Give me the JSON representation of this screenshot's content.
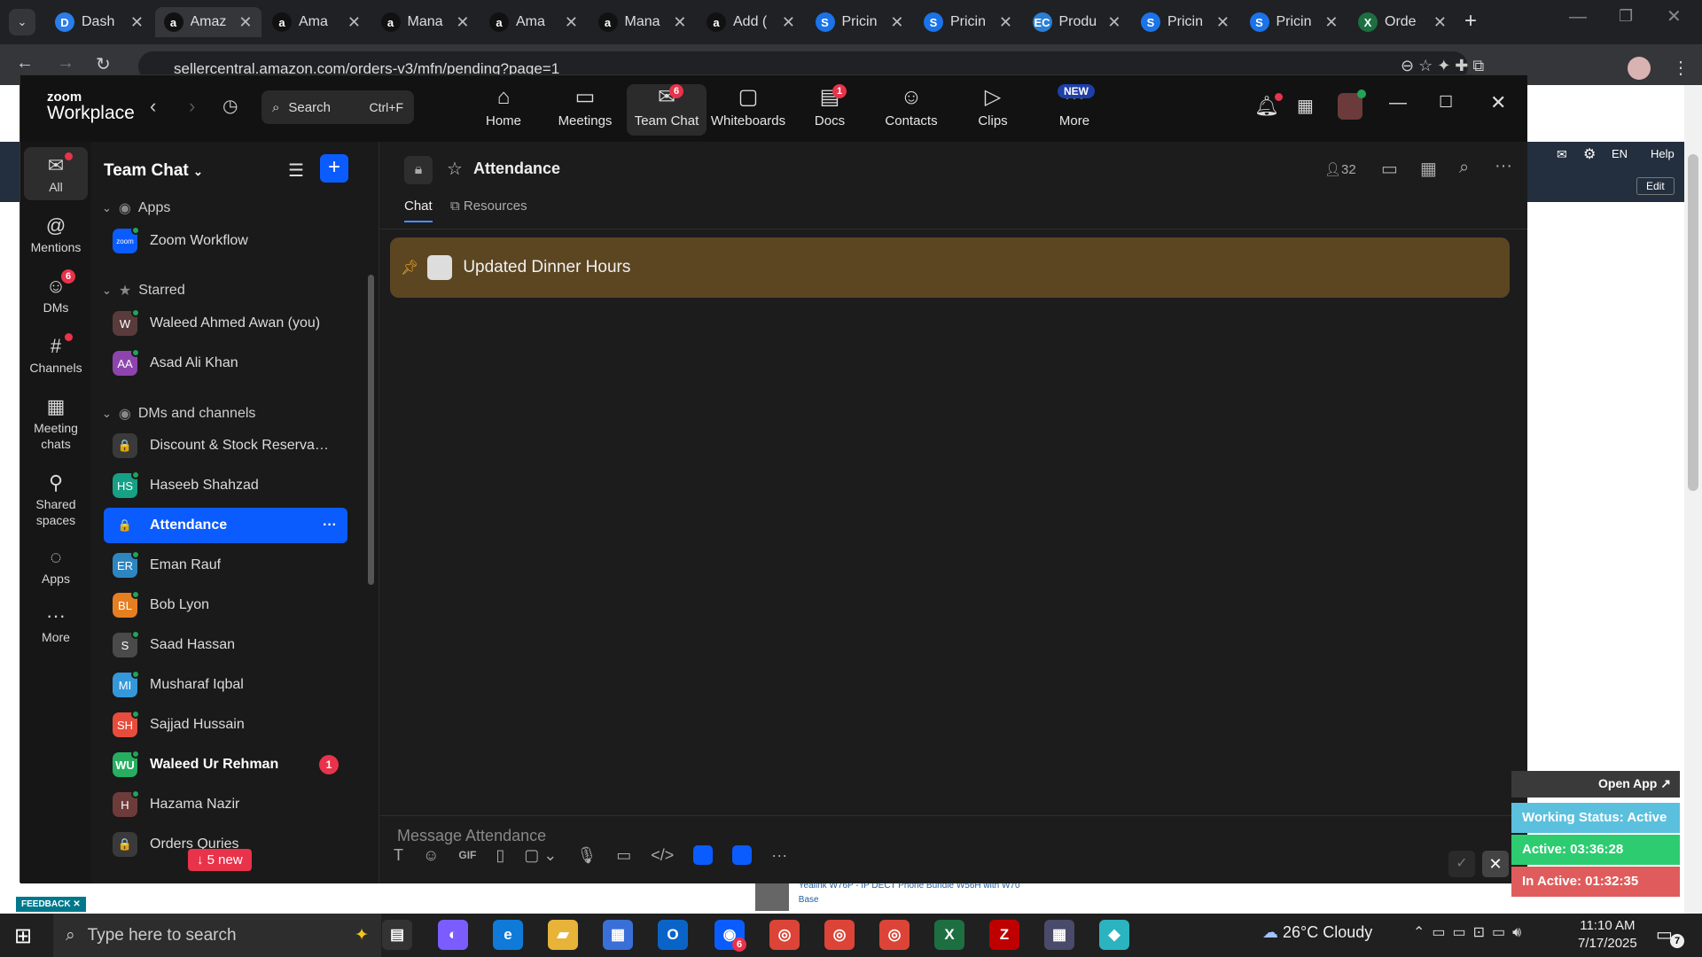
{
  "browser": {
    "tabs": [
      {
        "title": "Dash",
        "favicon": "D",
        "color": "#2b7de9"
      },
      {
        "title": "Amaz",
        "favicon": "a",
        "color": "#111111"
      },
      {
        "title": "Ama",
        "favicon": "a",
        "color": "#111111"
      },
      {
        "title": "Mana",
        "favicon": "a",
        "color": "#111111"
      },
      {
        "title": "Ama",
        "favicon": "a",
        "color": "#111111"
      },
      {
        "title": "Mana",
        "favicon": "a",
        "color": "#111111"
      },
      {
        "title": "Add (",
        "favicon": "a",
        "color": "#111111"
      },
      {
        "title": "Pricin",
        "favicon": "S",
        "color": "#1a73e8"
      },
      {
        "title": "Pricin",
        "favicon": "S",
        "color": "#1a73e8"
      },
      {
        "title": "Produ",
        "favicon": "EC",
        "color": "#2a7fd4"
      },
      {
        "title": "Pricin",
        "favicon": "S",
        "color": "#1a73e8"
      },
      {
        "title": "Pricin",
        "favicon": "S",
        "color": "#1a73e8"
      },
      {
        "title": "Orde",
        "favicon": "X",
        "color": "#1d6f42"
      }
    ],
    "url": "sellercentral.amazon.com/orders-v3/mfn/pending?page=1"
  },
  "amazon": {
    "lang": "EN",
    "help": "Help",
    "edit": "Edit",
    "feedback": "FEEDBACK",
    "product_line1": "Yealink W76P - IP DECT Phone Bundle W56H with W70",
    "product_line2": "Base",
    "open_app": "Open App"
  },
  "zoom": {
    "brand_top": "zoom",
    "brand_bottom": "Workplace",
    "search": {
      "label": "Search",
      "shortcut": "Ctrl+F"
    },
    "nav": [
      {
        "label": "Home",
        "icon": "home-icon",
        "glyph": "⌂"
      },
      {
        "label": "Meetings",
        "icon": "video-icon",
        "glyph": "▭"
      },
      {
        "label": "Team Chat",
        "icon": "chat-icon",
        "glyph": "✉",
        "badge": "6"
      },
      {
        "label": "Whiteboards",
        "icon": "whiteboard-icon",
        "glyph": "▢"
      },
      {
        "label": "Docs",
        "icon": "docs-icon",
        "glyph": "▤",
        "badge": "1"
      },
      {
        "label": "Contacts",
        "icon": "contacts-icon",
        "glyph": "☺"
      },
      {
        "label": "Clips",
        "icon": "clips-icon",
        "glyph": "▷"
      },
      {
        "label": "More",
        "icon": "more-icon",
        "glyph": "···",
        "tag": "NEW"
      }
    ],
    "rail": [
      {
        "label": "All",
        "glyph": "✉"
      },
      {
        "label": "Mentions",
        "glyph": "@"
      },
      {
        "label": "DMs",
        "glyph": "☺",
        "badge": "6"
      },
      {
        "label": "Channels",
        "glyph": "#"
      },
      {
        "label": "Meeting chats",
        "glyph": "▦"
      },
      {
        "label": "Shared spaces",
        "glyph": "⚲"
      },
      {
        "label": "Apps",
        "glyph": "◌"
      },
      {
        "label": "More",
        "glyph": "···"
      }
    ],
    "sidebar": {
      "title": "Team Chat",
      "sections": {
        "apps": "Apps",
        "starred": "Starred",
        "dms": "DMs and channels"
      },
      "apps": [
        {
          "name": "Zoom Workflow",
          "initials": "zoom",
          "color": "#0b5cff"
        }
      ],
      "starred": [
        {
          "name": "Waleed Ahmed Awan (you)",
          "initials": "W",
          "color": "#5a3b3b"
        },
        {
          "name": "Asad Ali Khan",
          "initials": "AA",
          "color": "#8e44ad"
        }
      ],
      "channels": [
        {
          "name": "Discount & Stock Reservatio...",
          "initials": "🔒",
          "color": "#3a3a3a"
        },
        {
          "name": "Haseeb Shahzad",
          "initials": "HS",
          "color": "#16a085"
        },
        {
          "name": "Attendance",
          "initials": "🔒",
          "color": "#0b5cff",
          "selected": true
        },
        {
          "name": "Eman Rauf",
          "initials": "ER",
          "color": "#2e86c1"
        },
        {
          "name": "Bob Lyon",
          "initials": "BL",
          "color": "#e67e22"
        },
        {
          "name": "Saad Hassan",
          "initials": "S",
          "color": "#4a4a4a"
        },
        {
          "name": "Musharaf Iqbal",
          "initials": "MI",
          "color": "#3498db"
        },
        {
          "name": "Sajjad Hussain",
          "initials": "SH",
          "color": "#e74c3c"
        },
        {
          "name": "Waleed Ur Rehman",
          "initials": "WU",
          "color": "#27ae60",
          "bold": true,
          "badge": "1"
        },
        {
          "name": "Hazama Nazir",
          "initials": "H",
          "color": "#6e3b3b"
        },
        {
          "name": "Orders Quries",
          "initials": "🔒",
          "color": "#3a3a3a"
        }
      ],
      "new_pill": "↓ 5 new"
    },
    "channel": {
      "name": "Attendance",
      "members": "32",
      "tabs": [
        "Chat",
        "Resources"
      ],
      "pinned": "Updated Dinner Hours",
      "composer_placeholder": "Message Attendance",
      "gif": "GIF"
    }
  },
  "widget": {
    "status": "Working Status: Active",
    "active": "Active: 03:36:28",
    "inactive": "In Active: 01:32:35",
    "colors": {
      "status": "#5bc0de",
      "active": "#2ecc71",
      "inactive": "#e05c5c"
    }
  },
  "taskbar": {
    "search": "Type here to search",
    "weather": "26°C  Cloudy",
    "time": "11:10 AM",
    "date": "7/17/2025",
    "notif": "7",
    "zoom_badge": "6"
  }
}
